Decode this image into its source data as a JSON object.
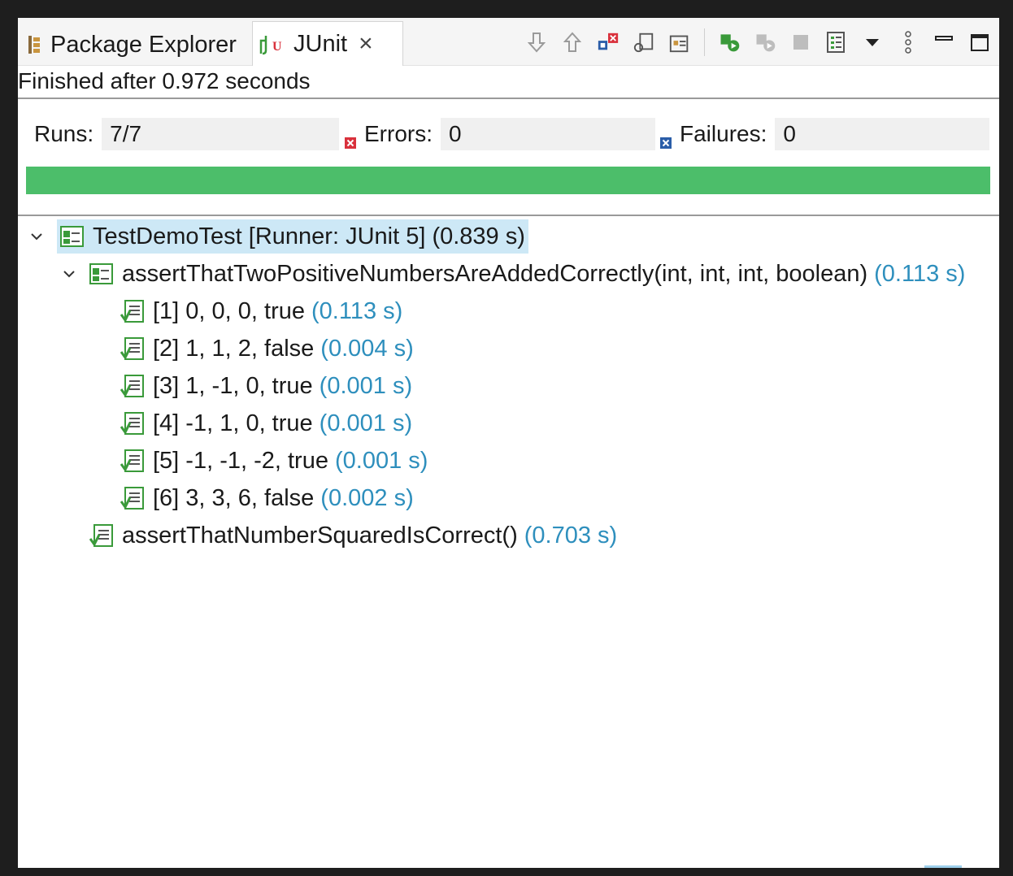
{
  "tabs": {
    "package_explorer": "Package Explorer",
    "junit": "JUnit"
  },
  "status": "Finished after 0.972 seconds",
  "counters": {
    "runs_label": "Runs:",
    "runs_value": "7/7",
    "errors_label": "Errors:",
    "errors_value": "0",
    "failures_label": "Failures:",
    "failures_value": "0"
  },
  "progress": {
    "fraction": 1.0,
    "color": "#4cbe6a"
  },
  "tree": {
    "root": {
      "label": "TestDemoTest [Runner: JUnit 5] (0.839 s)"
    },
    "param_test": {
      "label": "assertThatTwoPositiveNumbersAreAddedCorrectly(int, int, int, boolean)",
      "time": "(0.113 s)",
      "cases": [
        {
          "label": "[1] 0, 0, 0, true",
          "time": "(0.113 s)"
        },
        {
          "label": "[2] 1, 1, 2, false",
          "time": "(0.004 s)"
        },
        {
          "label": "[3] 1, -1, 0, true",
          "time": "(0.001 s)"
        },
        {
          "label": "[4] -1, 1, 0, true",
          "time": "(0.001 s)"
        },
        {
          "label": "[5] -1, -1, -2, true",
          "time": "(0.001 s)"
        },
        {
          "label": "[6] 3, 3, 6, false",
          "time": "(0.002 s)"
        }
      ]
    },
    "square_test": {
      "label": "assertThatNumberSquaredIsCorrect()",
      "time": "(0.703 s)"
    }
  },
  "icons": {
    "toolbar": [
      "next-failure-icon",
      "previous-failure-icon",
      "show-failures-only-icon",
      "scroll-lock-icon",
      "show-skipped-icon",
      "rerun-icon",
      "rerun-failed-first-icon",
      "stop-icon",
      "test-run-history-icon",
      "view-menu-icon",
      "more-options-icon",
      "minimize-icon",
      "maximize-icon"
    ]
  },
  "colors": {
    "time": "#2e8fbd",
    "selection": "#cde8f6",
    "pass": "#4cbe6a",
    "error": "#d9313c",
    "failure": "#2a5da8"
  }
}
